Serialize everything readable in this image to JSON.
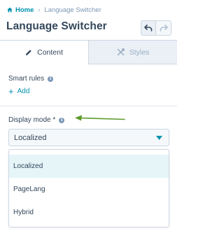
{
  "breadcrumb": {
    "home_label": "Home",
    "current_label": "Language Switcher"
  },
  "header": {
    "title": "Language Switcher"
  },
  "tabs": [
    {
      "label": "Content",
      "icon": "pencil-icon",
      "active": true
    },
    {
      "label": "Styles",
      "icon": "tools-icon",
      "active": false
    }
  ],
  "smart_rules": {
    "label": "Smart rules",
    "add_label": "Add"
  },
  "display_mode": {
    "label": "Display mode *",
    "selected_value": "Localized",
    "options": [
      "Localized",
      "PageLang",
      "Hybrid"
    ]
  },
  "colors": {
    "link": "#0091ae",
    "text": "#33475b",
    "arrow": "#5c9a29",
    "selected_option_bg": "#e5f5f8"
  }
}
